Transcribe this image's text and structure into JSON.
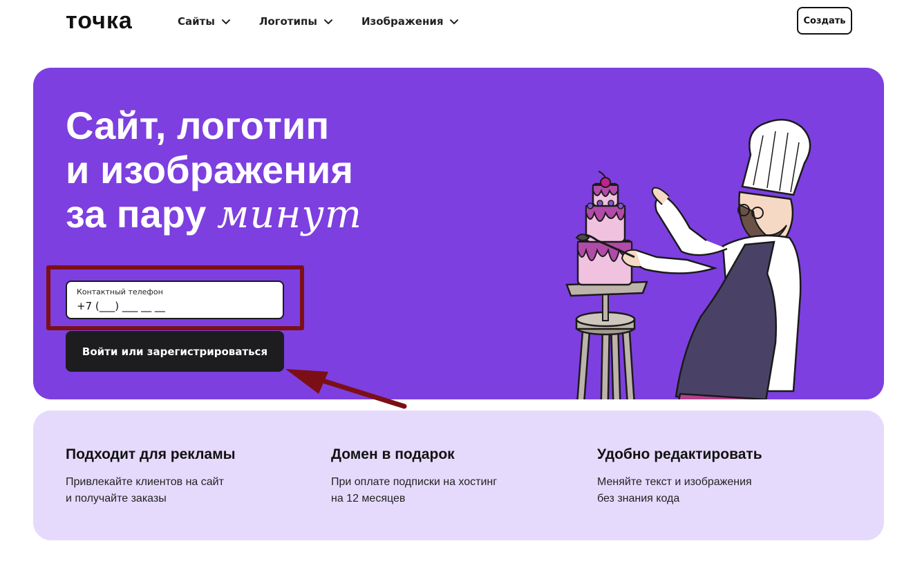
{
  "header": {
    "logo": "точка",
    "nav": [
      {
        "label": "Сайты"
      },
      {
        "label": "Логотипы"
      },
      {
        "label": "Изображения"
      }
    ],
    "create_label": "Создать"
  },
  "hero": {
    "title_line1": "Сайт, логотип",
    "title_line2": "и изображения",
    "title_line3_plain": "за пару ",
    "title_line3_script": "минут",
    "phone_label": "Контактный телефон",
    "phone_placeholder": "+7 (___) ___ __ __",
    "login_label": "Войти или зарегистрироваться"
  },
  "features": [
    {
      "title": "Подходит для рекламы",
      "line1": "Привлекайте клиентов на сайт",
      "line2": "и получайте заказы"
    },
    {
      "title": "Домен в подарок",
      "line1": "При оплате подписки на хостинг",
      "line2": "на 12 месяцев"
    },
    {
      "title": "Удобно редактировать",
      "line1": "Меняйте текст и изображения",
      "line2": "без знания кода"
    }
  ],
  "colors": {
    "hero_bg": "#7d3fe0",
    "features_bg": "#e6dafc",
    "annotation": "#7b0f15",
    "button_dark": "#1d1d1f"
  },
  "icons": {
    "nav_chevron": "chevron-down-icon",
    "illustration": "chef-decorating-cake-illustration"
  }
}
